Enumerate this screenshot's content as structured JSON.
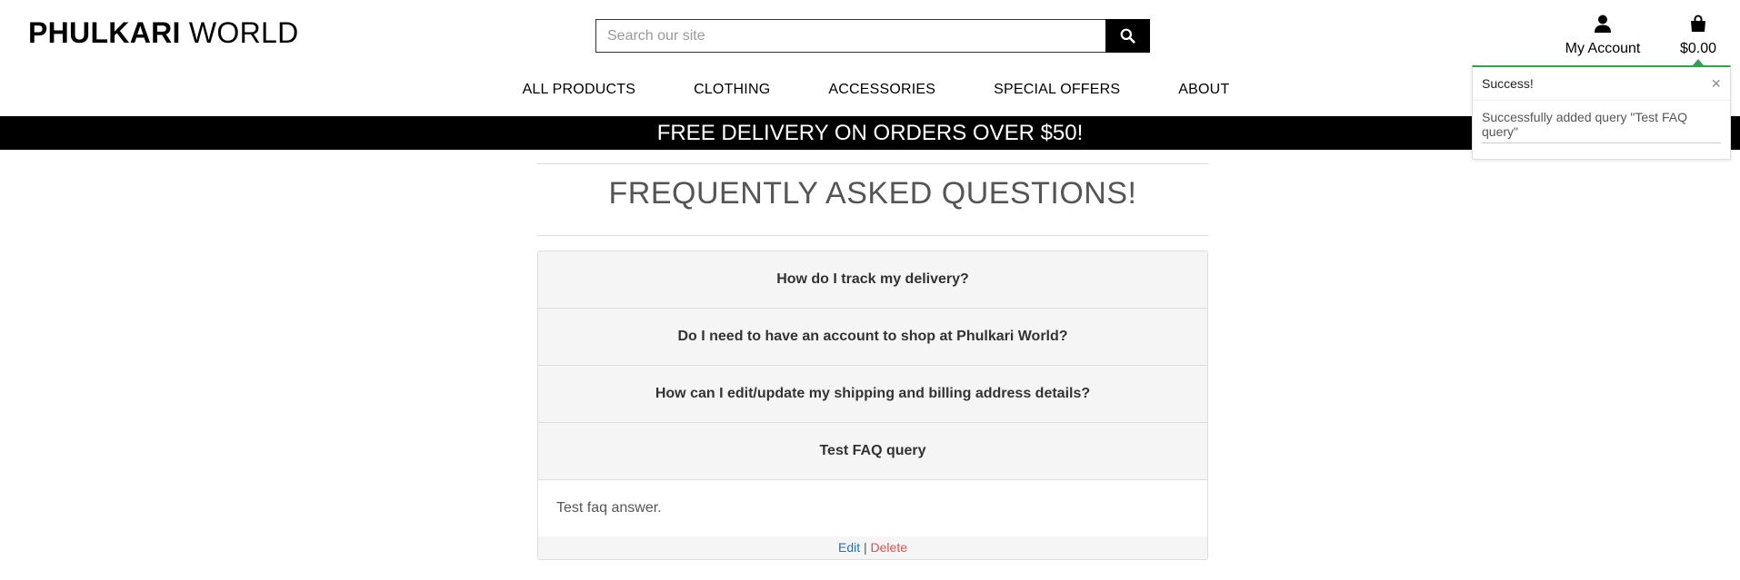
{
  "brand": {
    "bold": "PHULKARI",
    "regular": " WORLD"
  },
  "search": {
    "placeholder": "Search our site",
    "value": "",
    "icon": "search-icon"
  },
  "header": {
    "account_label": "My Account",
    "bag_total": "$0.00"
  },
  "nav": [
    "ALL PRODUCTS",
    "CLOTHING",
    "ACCESSORIES",
    "SPECIAL OFFERS",
    "ABOUT"
  ],
  "banner": "FREE DELIVERY ON ORDERS OVER $50!",
  "page_title": "FREQUENTLY ASKED QUESTIONS!",
  "faqs": [
    "How do I track my delivery?",
    "Do I need to have an account to shop at Phulkari World?",
    "How can I edit/update my shipping and billing address details?",
    "Test FAQ query"
  ],
  "open_answer": "Test faq answer.",
  "actions": {
    "edit": "Edit",
    "separator": "|",
    "delete": "Delete"
  },
  "toast": {
    "title": "Success!",
    "message": "Successfully added query \"Test FAQ query\"",
    "close": "×",
    "accent": "#28a745"
  },
  "colors": {
    "edit_link": "#1a73c5",
    "delete_link": "#d9534f",
    "banner_bg": "#000000"
  }
}
